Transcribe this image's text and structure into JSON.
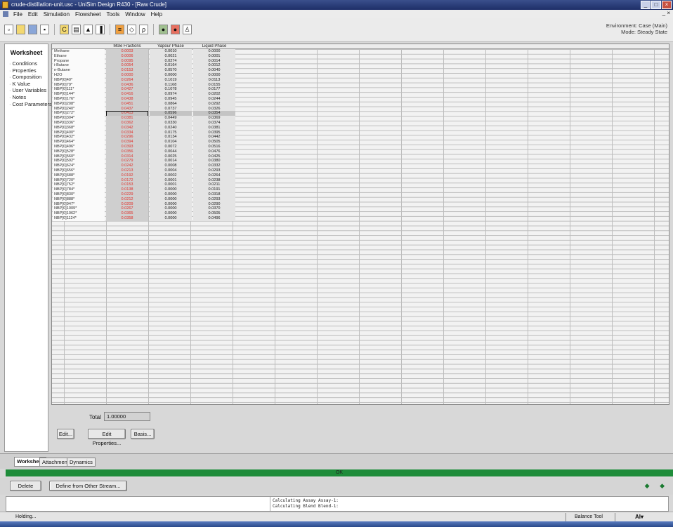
{
  "window": {
    "title": "crude-distillation-unit.usc - UniSim Design R430 - [Raw Crude]"
  },
  "menu": [
    "File",
    "Edit",
    "Simulation",
    "Flowsheet",
    "Tools",
    "Window",
    "Help"
  ],
  "environment": {
    "line1": "Environment: Case (Main)",
    "line2": "Mode: Steady State"
  },
  "sidebar": {
    "title": "Worksheet",
    "items": [
      "Conditions",
      "Properties",
      "Composition",
      "K Value",
      "User Variables",
      "Notes",
      "Cost Parameters"
    ]
  },
  "grid": {
    "headers": [
      "Mole Fractions",
      "Vapour Phase",
      "Liquid Phase"
    ],
    "rows": [
      {
        "c": "Methane",
        "m": "0.0003",
        "v": "0.0010",
        "l": "0.0000"
      },
      {
        "c": "Ethane",
        "m": "0.0006",
        "v": "0.0021",
        "l": "0.0001"
      },
      {
        "c": "Propane",
        "m": "0.0095",
        "v": "0.0274",
        "l": "0.0014"
      },
      {
        "c": "i-Butane",
        "m": "0.0054",
        "v": "0.0164",
        "l": "0.0012"
      },
      {
        "c": "n-Butane",
        "m": "0.0153",
        "v": "0.0570",
        "l": "0.0040"
      },
      {
        "c": "H2O",
        "m": "0.0000",
        "v": "0.0000",
        "l": "0.0000"
      },
      {
        "c": "NBP[0]40*",
        "m": "0.0264",
        "v": "0.1019",
        "l": "0.0113"
      },
      {
        "c": "NBP[0]79*",
        "m": "0.0436",
        "v": "0.1168",
        "l": "0.0155"
      },
      {
        "c": "NBP[0]111*",
        "m": "0.0427",
        "v": "0.1078",
        "l": "0.0177"
      },
      {
        "c": "NBP[0]144*",
        "m": "0.0416",
        "v": "0.0974",
        "l": "0.0202"
      },
      {
        "c": "NBP[0]176*",
        "m": "0.0438",
        "v": "0.0945",
        "l": "0.0244"
      },
      {
        "c": "NBP[0]208*",
        "m": "0.0451",
        "v": "0.0864",
        "l": "0.0292"
      },
      {
        "c": "NBP[0]240*",
        "m": "0.0437",
        "v": "0.0737",
        "l": "0.0326"
      },
      {
        "c": "NBP[0]272*",
        "m": "0.0413",
        "v": "0.0596",
        "l": "0.0354"
      },
      {
        "c": "NBP[0]304*",
        "m": "0.0381",
        "v": "0.0449",
        "l": "0.0369"
      },
      {
        "c": "NBP[0]336*",
        "m": "0.0362",
        "v": "0.0330",
        "l": "0.0374"
      },
      {
        "c": "NBP[0]368*",
        "m": "0.0342",
        "v": "0.0240",
        "l": "0.0381"
      },
      {
        "c": "NBP[0]400*",
        "m": "0.0334",
        "v": "0.0175",
        "l": "0.0395"
      },
      {
        "c": "NBP[0]432*",
        "m": "0.0296",
        "v": "0.0134",
        "l": "0.0442"
      },
      {
        "c": "NBP[0]464*",
        "m": "0.0394",
        "v": "0.0104",
        "l": "0.0505"
      },
      {
        "c": "NBP[0]496*",
        "m": "0.0393",
        "v": "0.0072",
        "l": "0.0516"
      },
      {
        "c": "NBP[0]528*",
        "m": "0.0356",
        "v": "0.0044",
        "l": "0.0476"
      },
      {
        "c": "NBP[0]560*",
        "m": "0.0314",
        "v": "0.0025",
        "l": "0.0425"
      },
      {
        "c": "NBP[0]592*",
        "m": "0.0279",
        "v": "0.0014",
        "l": "0.0380"
      },
      {
        "c": "NBP[0]624*",
        "m": "0.0242",
        "v": "0.0008",
        "l": "0.0332"
      },
      {
        "c": "NBP[0]656*",
        "m": "0.0213",
        "v": "0.0004",
        "l": "0.0293"
      },
      {
        "c": "NBP[0]688*",
        "m": "0.0192",
        "v": "0.0002",
        "l": "0.0264"
      },
      {
        "c": "NBP[0]720*",
        "m": "0.0172",
        "v": "0.0001",
        "l": "0.0238"
      },
      {
        "c": "NBP[0]752*",
        "m": "0.0153",
        "v": "0.0001",
        "l": "0.0211"
      },
      {
        "c": "NBP[0]784*",
        "m": "0.0138",
        "v": "0.0000",
        "l": "0.0191"
      },
      {
        "c": "NBP[0]830*",
        "m": "0.0229",
        "v": "0.0000",
        "l": "0.0318"
      },
      {
        "c": "NBP[0]888*",
        "m": "0.0212",
        "v": "0.0000",
        "l": "0.0293"
      },
      {
        "c": "NBP[0]947*",
        "m": "0.0209",
        "v": "0.0000",
        "l": "0.0290"
      },
      {
        "c": "NBP[0]1009*",
        "m": "0.0267",
        "v": "0.0000",
        "l": "0.0370"
      },
      {
        "c": "NBP[0]1062*",
        "m": "0.0365",
        "v": "0.0000",
        "l": "0.0505"
      },
      {
        "c": "NBP[0]1124*",
        "m": "0.0358",
        "v": "0.0000",
        "l": "0.0496"
      }
    ],
    "selected_row": 13
  },
  "total": {
    "label": "Total",
    "value": "1.00000"
  },
  "buttons": {
    "edit": "Edit...",
    "edit_properties": "Edit Properties...",
    "basis": "Basis...",
    "delete": "Delete",
    "define": "Define from Other Stream..."
  },
  "tabs": [
    "Worksheet",
    "Attachments",
    "Dynamics"
  ],
  "status": {
    "ok": "OK",
    "left": "Holding...",
    "balance": "Balance Tool",
    "icons": "AI▾"
  },
  "messages": [
    "Calculating Assay Assay-1:",
    "Calculating Blend Blend-1:"
  ],
  "nav_arrows": "◆ ◆"
}
